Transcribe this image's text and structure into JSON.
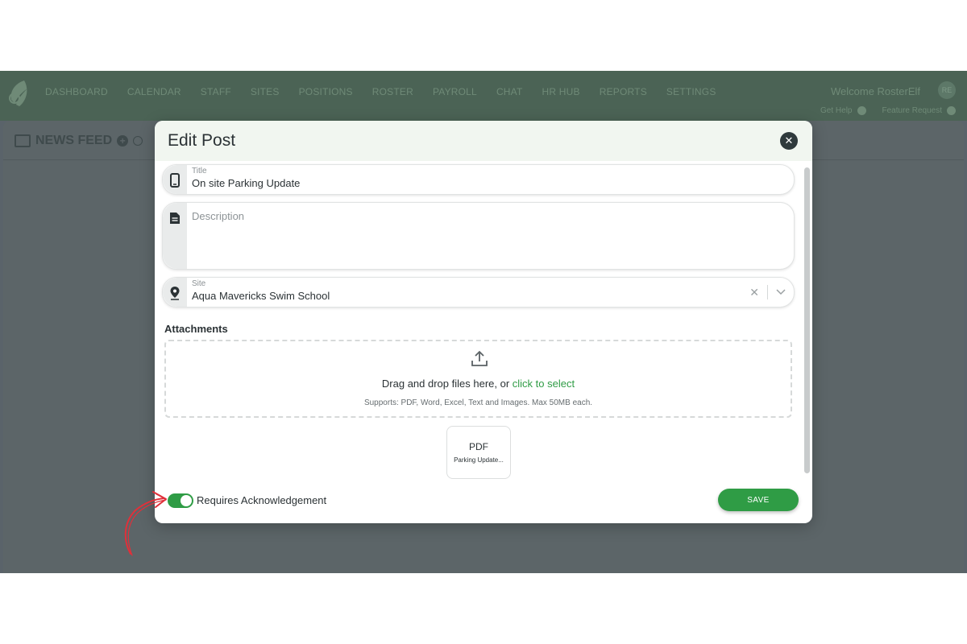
{
  "nav": {
    "items": [
      "DASHBOARD",
      "CALENDAR",
      "STAFF",
      "SITES",
      "POSITIONS",
      "ROSTER",
      "PAYROLL",
      "CHAT",
      "HR HUB",
      "REPORTS",
      "SETTINGS"
    ],
    "welcome": "Welcome RosterElf",
    "avatar_initials": "RE",
    "get_help": "Get Help",
    "feature_request": "Feature Request"
  },
  "page": {
    "section_title": "NEWS FEED"
  },
  "modal": {
    "title": "Edit Post",
    "title_field": {
      "label": "Title",
      "value": "On site Parking Update"
    },
    "description_field": {
      "placeholder": "Description"
    },
    "site_field": {
      "label": "Site",
      "value": "Aqua Mavericks Swim School"
    },
    "attachments_label": "Attachments",
    "dropzone": {
      "text": "Drag and drop files here, or ",
      "link": "click to select",
      "supports": "Supports: PDF, Word, Excel, Text and Images. Max 50MB each."
    },
    "attachment": {
      "type": "PDF",
      "name": "Parking Update..."
    },
    "acknowledgement_label": "Requires Acknowledgement",
    "acknowledgement_enabled": true,
    "save_label": "SAVE"
  },
  "colors": {
    "accent": "#2f9c45",
    "navbar": "#4b6355",
    "overlay": "#5a636a",
    "annotation": "#e0303a"
  },
  "icons": {
    "title": "phone-icon",
    "description": "document-icon",
    "site": "location-pin-icon",
    "upload": "upload-icon",
    "close": "close-icon"
  }
}
